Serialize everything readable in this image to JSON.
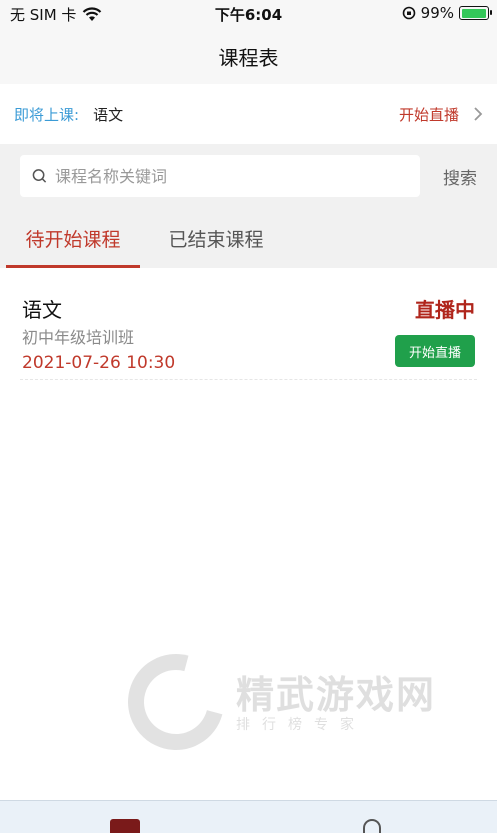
{
  "status_bar": {
    "carrier": "无 SIM 卡",
    "time": "下午6:04",
    "battery": "99%",
    "battery_level": 0.99,
    "battery_color": "#34c759"
  },
  "nav": {
    "title": "课程表"
  },
  "upcoming": {
    "label": "即将上课:",
    "course": "语文",
    "action": "开始直播",
    "chevron_icon": "chevron-right-icon"
  },
  "search": {
    "placeholder": "课程名称关键词",
    "button": "搜索",
    "icon": "search-icon"
  },
  "tabs": [
    {
      "label": "待开始课程",
      "active": true
    },
    {
      "label": "已结束课程",
      "active": false
    }
  ],
  "courses": [
    {
      "name": "语文",
      "class": "初中年级培训班",
      "time": "2021-07-26 10:30",
      "status": "直播中",
      "action": "开始直播"
    }
  ],
  "watermark": {
    "title": "精武游戏网",
    "subtitle": "排行榜专家"
  },
  "colors": {
    "accent": "#c0392b",
    "live_status": "#b0261c",
    "start_button": "#20a04b",
    "upcoming_label": "#3b9bd6"
  }
}
